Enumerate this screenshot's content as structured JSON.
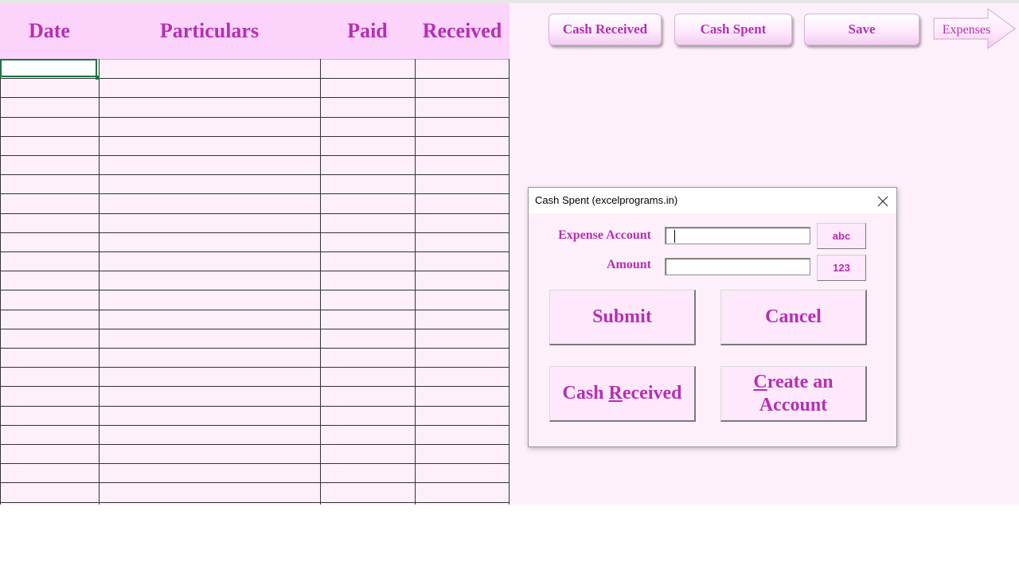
{
  "sheet": {
    "columns": [
      "Date",
      "Particulars",
      "Paid",
      "Received"
    ]
  },
  "toolbar": {
    "cash_received_label": "Cash Received",
    "cash_spent_label": "Cash Spent",
    "save_label": "Save",
    "expenses_label": "Expenses"
  },
  "dialog": {
    "title": "Cash Spent (excelprograms.in)",
    "expense_account_label": "Expense Account",
    "expense_account_value": "",
    "amount_label": "Amount",
    "amount_value": "",
    "abc_button": "abc",
    "num_button": "123",
    "submit_label": "Submit",
    "cancel_label": "Cancel",
    "cash_received_first": "Cash ",
    "cash_received_hotkey": "R",
    "cash_received_rest": "eceived",
    "create_account_hotkey": "C",
    "create_account_line1_rest": "reate an",
    "create_account_line2": "Account"
  },
  "colors": {
    "accent": "#b52fb4",
    "header_fill": "#fcd4fb",
    "sheet_fill": "#fdf0fb",
    "active_cell_border": "#1e7145"
  },
  "icons": {
    "close": "close-icon",
    "arrow": "arrow-right-icon"
  }
}
